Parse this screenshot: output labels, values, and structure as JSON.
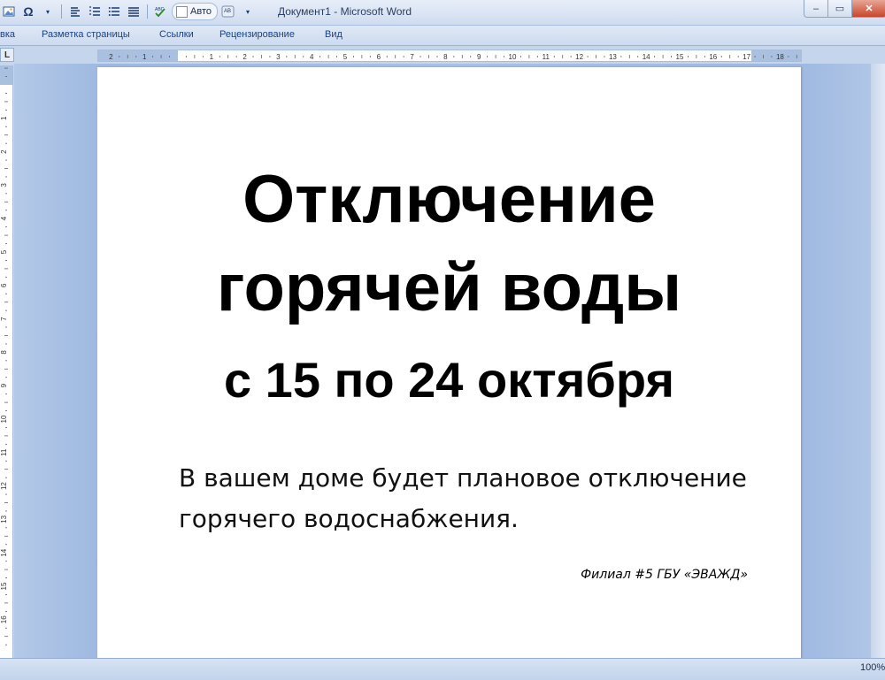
{
  "window": {
    "title": "Документ1 - Microsoft Word",
    "minimize_glyph": "–",
    "maximize_glyph": "▭",
    "close_glyph": "✕"
  },
  "quick_access": {
    "auto_label": "Авто",
    "omega_glyph": "Ω",
    "icons": [
      "picture-icon",
      "omega-icon",
      "outline-icon",
      "numbering-icon",
      "list-icon",
      "spelling-icon",
      "abc-icon"
    ]
  },
  "ribbon": {
    "tabs": [
      {
        "label": "вка"
      },
      {
        "label": "Разметка страницы"
      },
      {
        "label": "Ссылки"
      },
      {
        "label": "Рецензирование"
      },
      {
        "label": "Вид"
      }
    ]
  },
  "ruler": {
    "corner_glyph": "L",
    "h_labels": [
      "2",
      "1",
      "1",
      "2",
      "3",
      "4",
      "5",
      "6",
      "7",
      "8",
      "9",
      "10",
      "11",
      "12",
      "13",
      "14",
      "15",
      "16",
      "17",
      "18"
    ],
    "v_labels": [
      "1",
      "1",
      "2",
      "3",
      "4",
      "5",
      "6",
      "7",
      "8",
      "9",
      "10",
      "11",
      "12",
      "13",
      "14",
      "15",
      "16"
    ]
  },
  "document": {
    "title_line1": "Отключение",
    "title_line2": "горячей воды",
    "subtitle": "с 15 по 24 октября",
    "body": "В вашем доме будет плановое отключение горячего водоснабжения.",
    "signature": "Филиал #5 ГБУ «ЭВАЖД»"
  },
  "status": {
    "zoom": "100%"
  },
  "colors": {
    "accent": "#15428b",
    "workspace": "#a9c1e4",
    "close": "#c8452b"
  }
}
